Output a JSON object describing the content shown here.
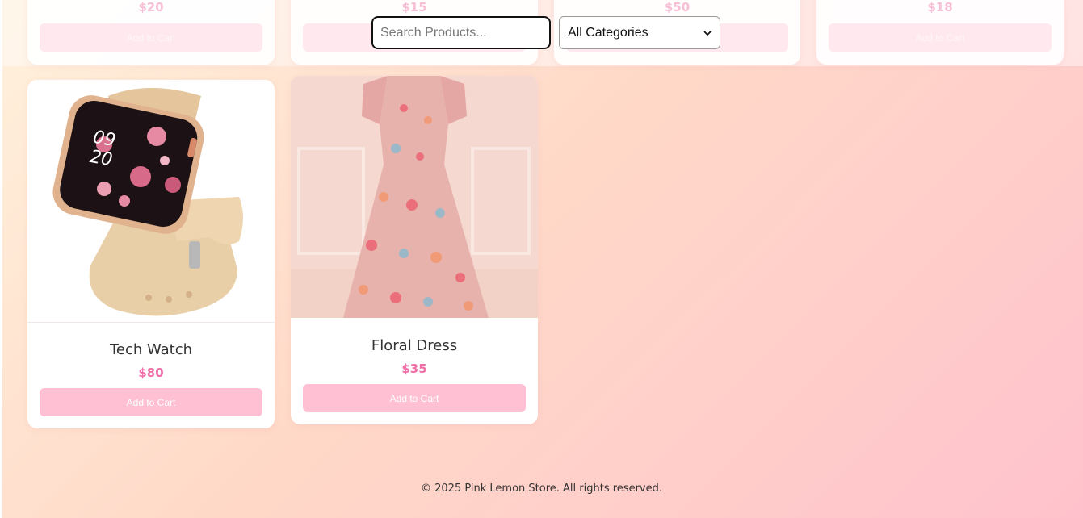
{
  "search": {
    "placeholder": "Search Products..."
  },
  "category_filter": {
    "selected": "All Categories",
    "icon": "chevron-down-icon"
  },
  "top_row_products": [
    {
      "price": "$20",
      "button_label": "Add to Cart"
    },
    {
      "price": "$15",
      "button_label": "Add to Cart"
    },
    {
      "price": "$50",
      "button_label": "Add to Cart"
    },
    {
      "price": "$18",
      "button_label": "Add to Cart"
    }
  ],
  "products": [
    {
      "name": "Tech Watch",
      "price": "$80",
      "button_label": "Add to Cart",
      "image": "smartwatch-image"
    },
    {
      "name": "Floral Dress",
      "price": "$35",
      "button_label": "Add to Cart",
      "image": "floral-dress-image"
    }
  ],
  "footer": {
    "text": "© 2025 Pink Lemon Store. All rights reserved."
  },
  "colors": {
    "price": "#ef6fa8",
    "button": "#ffc0d3",
    "brand_pink": "#ffc2cc"
  }
}
